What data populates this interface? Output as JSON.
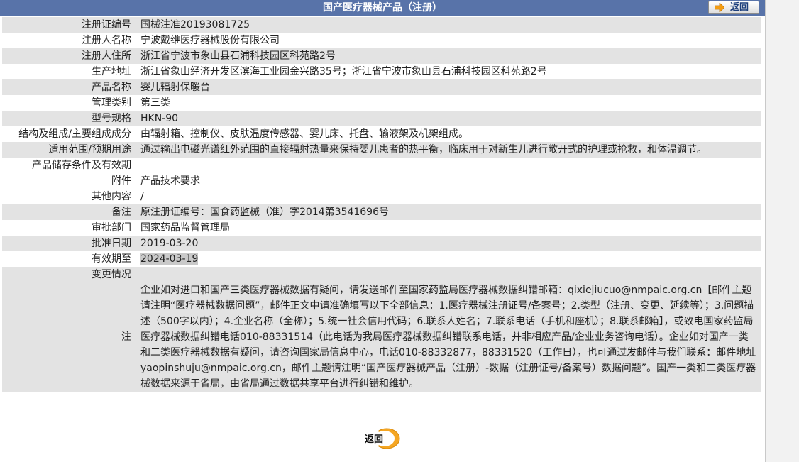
{
  "header": {
    "title": "国产医疗器械产品（注册）",
    "back_label": "返回"
  },
  "rows": [
    {
      "label": "注册证编号",
      "value": "国械注准20193081725"
    },
    {
      "label": "注册人名称",
      "value": "宁波戴维医疗器械股份有限公司"
    },
    {
      "label": "注册人住所",
      "value": "浙江省宁波市象山县石浦科技园区科苑路2号"
    },
    {
      "label": "生产地址",
      "value": "浙江省象山经济开发区滨海工业园金兴路35号；浙江省宁波市象山县石浦科技园区科苑路2号"
    },
    {
      "label": "产品名称",
      "value": "婴儿辐射保暖台"
    },
    {
      "label": "管理类别",
      "value": "第三类"
    },
    {
      "label": "型号规格",
      "value": "HKN-90"
    },
    {
      "label": "结构及组成/主要组成成分",
      "value": "由辐射箱、控制仪、皮肤温度传感器、婴儿床、托盘、输液架及机架组成。"
    },
    {
      "label": "适用范围/预期用途",
      "value": "通过输出电磁光谱红外范围的直接辐射热量来保持婴儿患者的热平衡，临床用于对新生儿进行敞开式的护理或抢救，和体温调节。"
    },
    {
      "label": "产品储存条件及有效期",
      "value": ""
    },
    {
      "label": "附件",
      "value": "产品技术要求"
    },
    {
      "label": "其他内容",
      "value": "/"
    },
    {
      "label": "备注",
      "value": "原注册证编号：国食药监械（准）字2014第3541696号"
    },
    {
      "label": "审批部门",
      "value": "国家药品监督管理局"
    },
    {
      "label": "批准日期",
      "value": "2019-03-20"
    },
    {
      "label": "有效期至",
      "value": "2024-03-19"
    },
    {
      "label": "变更情况",
      "value": ""
    },
    {
      "label": "注",
      "value": "企业如对进口和国产三类医疗器械数据有疑问，请发送邮件至国家药监局医疗器械数据纠错邮箱：qixiejiucuo@nmpaic.org.cn【邮件主题请注明“医疗器械数据问题”，邮件正文中请准确填写以下全部信息：1.医疗器械注册证号/备案号；2.类型（注册、变更、延续等）；3.问题描述（500字以内）；4.企业名称（全称）；5.统一社会信用代码；6.联系人姓名；7.联系电话（手机和座机）；8.联系邮箱】，或致电国家药监局医疗器械数据纠错电话010-88331514（此电话为我局医疗器械数据纠错联系电话，并非相应产品/企业业务咨询电话）。企业如对国产一类和二类医疗器械数据有疑问，请咨询国家局信息中心，电话010-88332877，88331520（工作日），也可通过发邮件与我们联系：邮件地址yaopinshuju@nmpaic.org.cn，邮件主题请注明“国产医疗器械产品（注册）-数据（注册证号/备案号）数据问题”。国产一类和二类医疗器械数据来源于省局，由省局通过数据共享平台进行纠错和维护。"
    }
  ],
  "footer": {
    "back_label": "返回"
  },
  "colors": {
    "header_bg": "#5873a9",
    "row_gray": "#e3e3e3",
    "button_orange": "#f5a623"
  }
}
